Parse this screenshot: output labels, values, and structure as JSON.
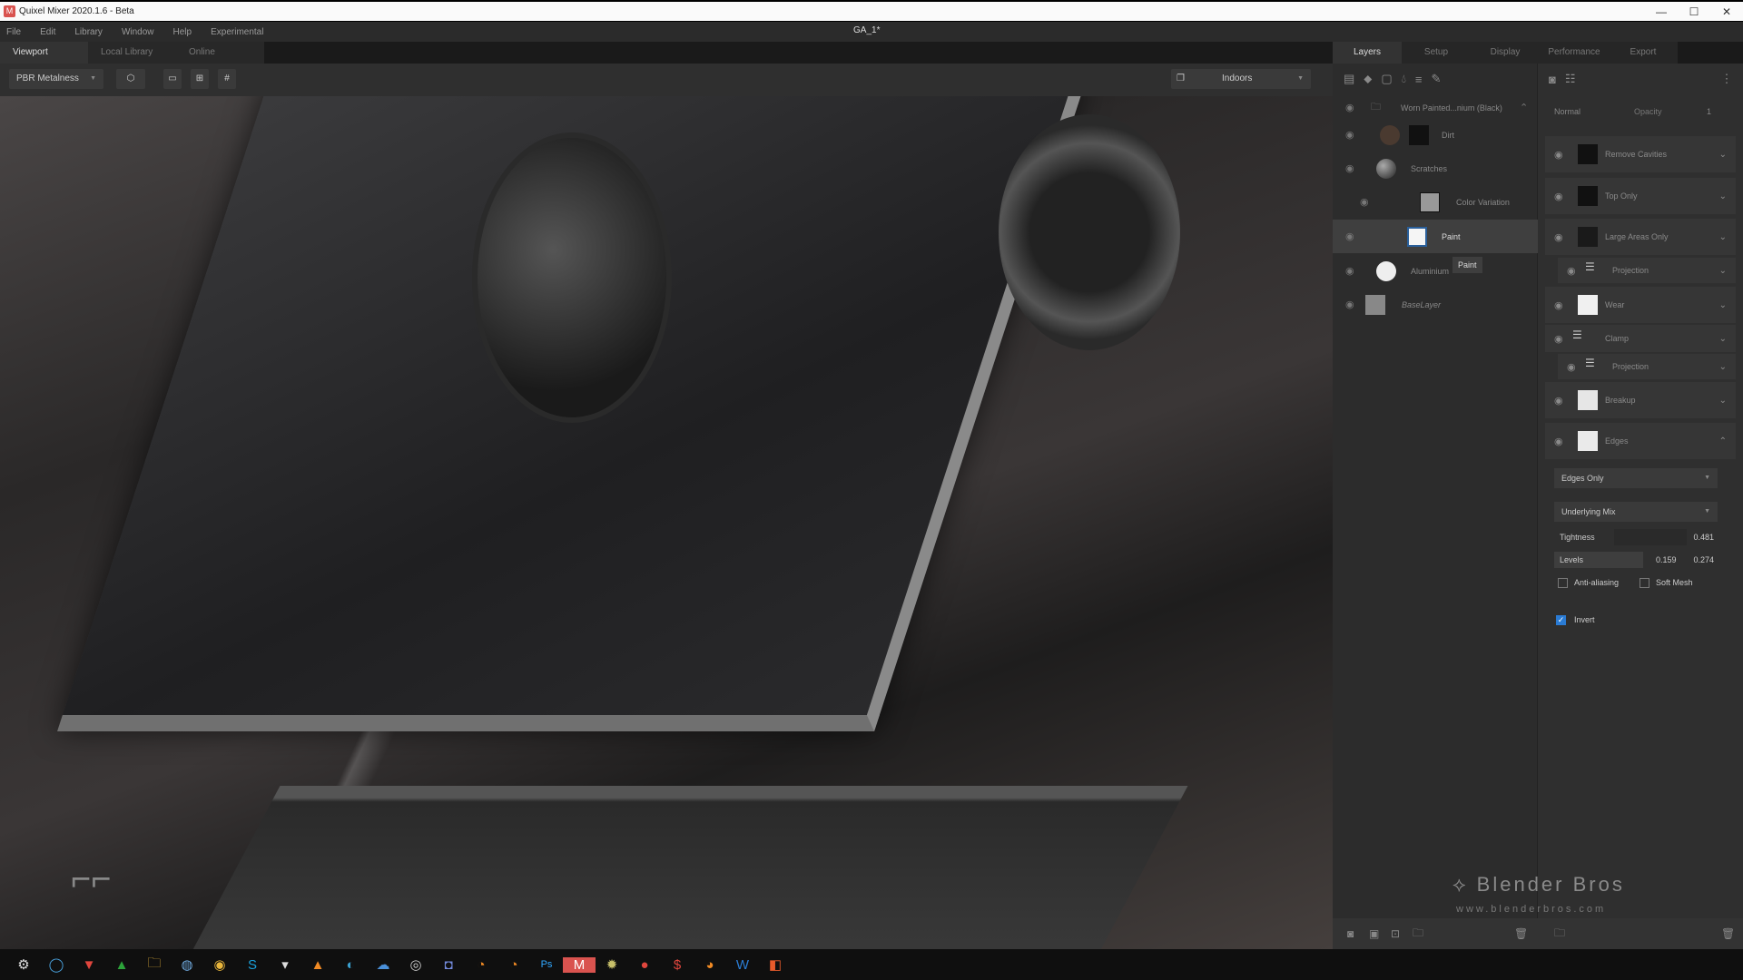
{
  "window": {
    "app_title": "Quixel Mixer 2020.1.6 - Beta",
    "document_title": "GA_1*",
    "controls": {
      "minimize": "—",
      "maximize": "☐",
      "close": "✕"
    }
  },
  "menu": [
    "File",
    "Edit",
    "Library",
    "Window",
    "Help",
    "Experimental"
  ],
  "left_tabs": [
    {
      "label": "Viewport",
      "active": true
    },
    {
      "label": "Local Library",
      "active": false
    },
    {
      "label": "Online",
      "active": false
    }
  ],
  "right_tabs": [
    {
      "label": "Layers",
      "active": true
    },
    {
      "label": "Setup",
      "active": false
    },
    {
      "label": "Display",
      "active": false
    },
    {
      "label": "Performance",
      "active": false
    },
    {
      "label": "Export",
      "active": false
    }
  ],
  "viewport_toolbar": {
    "render_mode": "PBR Metalness",
    "environment": "Indoors",
    "icons": [
      "cube-icon",
      "single-view-icon",
      "quad-view-icon",
      "grid-view-icon",
      "camera-icon"
    ]
  },
  "layers_toolbar_icons": [
    "add-layer-icon",
    "surface-icon",
    "solid-icon",
    "drop-icon",
    "stack-icon",
    "paint-brush-icon"
  ],
  "props_toolbar_icons": [
    "mask-icon",
    "adjust-icon",
    "more-icon"
  ],
  "layers": {
    "group": "Worn Painted...nium (Black)",
    "items": [
      {
        "name": "Dirt",
        "selected": false
      },
      {
        "name": "Scratches",
        "selected": false
      },
      {
        "name": "Color Variation",
        "selected": false
      },
      {
        "name": "Paint",
        "selected": true
      },
      {
        "name": "Aluminium",
        "selected": false
      },
      {
        "name": "BaseLayer",
        "selected": false
      }
    ],
    "tooltip": "Paint"
  },
  "properties": {
    "blend_mode": "Normal",
    "opacity_label": "Opacity",
    "opacity_value": "1",
    "mask_stack": [
      {
        "label": "Remove Cavities",
        "sub": false
      },
      {
        "label": "Top Only",
        "sub": false
      },
      {
        "label": "Large Areas Only",
        "sub": false
      },
      {
        "label": "Projection",
        "sub": true
      },
      {
        "label": "Wear",
        "sub": false
      },
      {
        "label": "Clamp",
        "sub": false
      },
      {
        "label": "Projection",
        "sub": true
      },
      {
        "label": "Breakup",
        "sub": false
      },
      {
        "label": "Edges",
        "sub": false,
        "expanded": true
      }
    ],
    "edges": {
      "mode": "Edges Only",
      "mix": "Underlying Mix",
      "tightness_label": "Tightness",
      "tightness": "0.481",
      "levels_label": "Levels",
      "levels_low": "0.159",
      "levels_high": "0.274",
      "anti_aliasing_label": "Anti-aliasing",
      "anti_aliasing": false,
      "soft_mesh_label": "Soft Mesh",
      "soft_mesh": false,
      "invert_label": "Invert",
      "invert": true
    }
  },
  "watermark": {
    "brand": "Blender Bros",
    "url": "www.blenderbros.com"
  },
  "taskbar_icons": [
    "steam-icon",
    "cortana-icon",
    "vivaldi-icon",
    "green-app-icon",
    "file-explorer-icon",
    "globe-icon",
    "chrome-icon",
    "skype-icon",
    "fox-icon",
    "vlc-icon",
    "edge-icon",
    "cloud-icon",
    "obs-icon",
    "discord-icon",
    "blender-icon",
    "blender-icon",
    "photoshop-icon",
    "mixer-icon",
    "settings-icon",
    "red-app-icon",
    "s-app-icon",
    "firefox-icon",
    "word-icon",
    "office-icon"
  ]
}
